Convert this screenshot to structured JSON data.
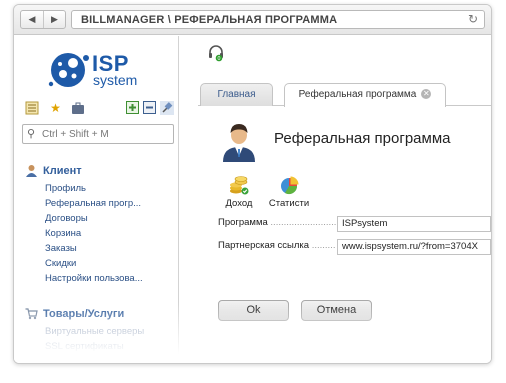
{
  "browser": {
    "back": "◀",
    "forward": "▶",
    "url": "BILLMANAGER \\ РЕФЕРАЛЬНАЯ ПРОГРАММА"
  },
  "logo": {
    "text": "ISP",
    "subtext": "system"
  },
  "sidebar": {
    "search_placeholder": "Ctrl + Shift + M",
    "groups": [
      {
        "title": "Клиент",
        "icon": "user-icon",
        "items": [
          "Профиль",
          "Реферальная прогр...",
          "Договоры",
          "Корзина",
          "Заказы",
          "Скидки",
          "Настройки пользова..."
        ]
      },
      {
        "title": "Товары/Услуги",
        "icon": "cart-icon",
        "items": [
          "Виртуальные серверы",
          "SSL сертификаты"
        ]
      }
    ]
  },
  "main": {
    "tabs": [
      {
        "label": "Главная"
      },
      {
        "label": "Реферальная программа"
      }
    ],
    "page_title": "Реферальная программа",
    "actions": [
      {
        "label": "Доход",
        "icon": "coins-icon"
      },
      {
        "label": "Статисти",
        "icon": "pie-chart-icon"
      }
    ],
    "form": {
      "program_label": "Программа",
      "program_value": "ISPsystem",
      "link_label": "Партнерская ссылка",
      "link_value": "www.ispsystem.ru/?from=3704X"
    },
    "buttons": {
      "ok": "Ok",
      "cancel": "Отмена"
    }
  },
  "colors": {
    "link": "#2a4f85",
    "heading": "#335f9c",
    "brand": "#1e5aa8"
  }
}
